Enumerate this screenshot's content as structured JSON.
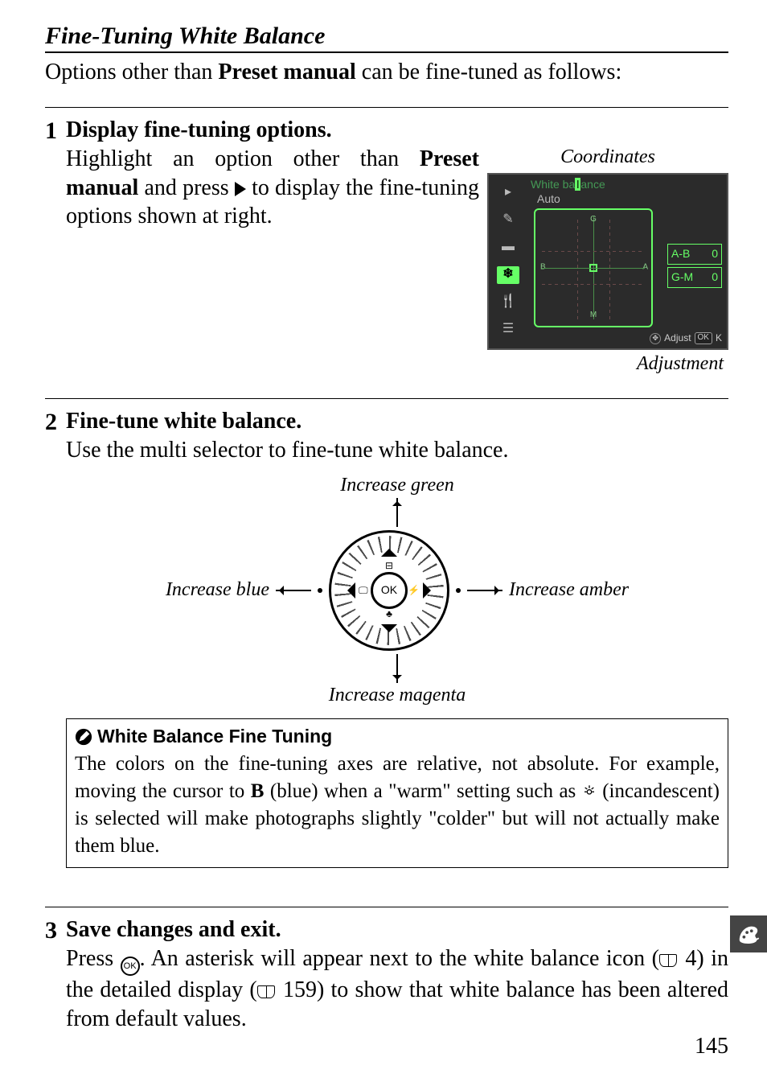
{
  "title": "Fine-Tuning White Balance",
  "intro_pre": "Options other than ",
  "intro_bold": "Preset manual",
  "intro_post": " can be fine-tuned as follows:",
  "step1": {
    "num": "1",
    "head": "Display fine-tuning options.",
    "text_pre": "Highlight an option other than ",
    "text_bold": "Preset manual",
    "text_mid": " and press ",
    "text_post": " to display the fine-tuning options shown at right.",
    "caption_top": "Coordinates",
    "caption_bot": "Adjustment"
  },
  "lcd": {
    "title_a": "White ba",
    "title_b": "ance",
    "sub": "Auto",
    "g": "G",
    "m": "M",
    "b": "B",
    "a": "A",
    "ab_label": "A-B",
    "ab_val": "0",
    "gm_label": "G-M",
    "gm_val": "0",
    "adjust": "Adjust",
    "ok": "OK",
    "k": "K",
    "side_icons": [
      "▸",
      "✎",
      "▬",
      "❄",
      "🍴",
      "☰"
    ]
  },
  "step2": {
    "num": "2",
    "head": "Fine-tune white balance.",
    "text": "Use the multi selector to fine-tune white balance.",
    "inc_green": "Increase green",
    "inc_blue": "Increase blue",
    "inc_amber": "Increase amber",
    "inc_magenta": "Increase magenta",
    "ok": "OK"
  },
  "note": {
    "head": "White Balance Fine Tuning",
    "l1": "The colors on the fine-tuning axes are relative, not absolute.  For example, moving the cursor to ",
    "b_letter": "B",
    "l2": " (blue) when a \"warm\" setting such as ",
    "l3": " (incandescent) is selected will make photographs slightly \"colder\" but will not actually make them blue."
  },
  "step3": {
    "num": "3",
    "head": "Save changes and exit.",
    "t1": "Press ",
    "t2": ".  An asterisk will appear next to the white balance icon (",
    "ref1": " 4) in the detailed display (",
    "ref2": " 159) to show that white balance has been altered from default values."
  },
  "page": "145"
}
